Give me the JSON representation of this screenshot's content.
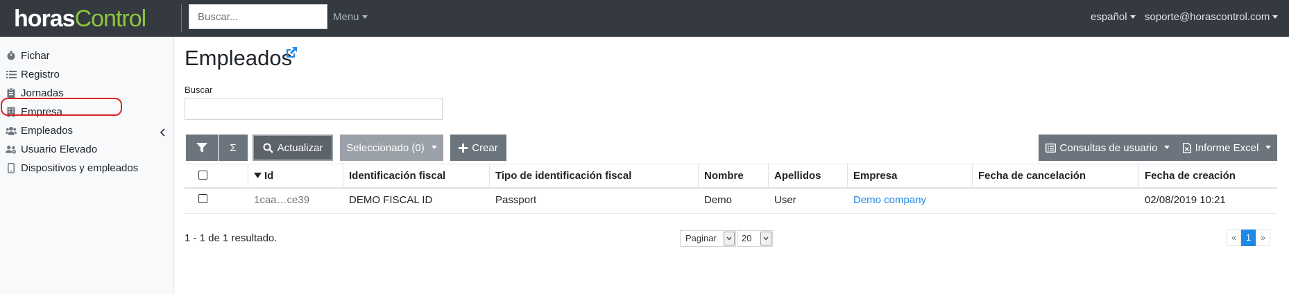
{
  "app": {
    "logo_part1": "horas",
    "logo_part2": "Control",
    "search_placeholder": "Buscar...",
    "menu_label": "Menu",
    "language_label": "español",
    "user_label": "soporte@horascontrol.com"
  },
  "colors": {
    "topbar": "#343a40",
    "logo_accent": "#8cc63e",
    "link": "#1e88e5",
    "button": "#6c757d",
    "highlight": "#e02020",
    "active_page": "#1e88e5"
  },
  "sidebar": {
    "items": [
      {
        "label": "Fichar",
        "icon": "stopwatch-icon"
      },
      {
        "label": "Registro",
        "icon": "list-icon"
      },
      {
        "label": "Jornadas",
        "icon": "clipboard-icon"
      },
      {
        "label": "Empresa",
        "icon": "building-icon"
      },
      {
        "label": "Empleados",
        "icon": "users-icon"
      },
      {
        "label": "Usuario Elevado",
        "icon": "users-cog-icon"
      },
      {
        "label": "Dispositivos y empleados",
        "icon": "mobile-icon"
      }
    ],
    "collapse_icon": "chevron-left-icon"
  },
  "main": {
    "title": "Empleados",
    "search_label": "Buscar",
    "toolbar": {
      "filter_icon": "filter-icon",
      "sum_label": "Σ",
      "refresh_label": "Actualizar",
      "selected_label": "Seleccionado (0)",
      "create_label": "Crear",
      "user_queries_label": "Consultas de usuario",
      "excel_label": "Informe Excel"
    },
    "table": {
      "columns": [
        "Id",
        "Identificación fiscal",
        "Tipo de identificación fiscal",
        "Nombre",
        "Apellidos",
        "Empresa",
        "Fecha de cancelación",
        "Fecha de creación"
      ],
      "rows": [
        {
          "id": "1caa…ce39",
          "fiscal_id": "DEMO FISCAL ID",
          "fiscal_type": "Passport",
          "nombre": "Demo",
          "apellidos": "User",
          "empresa": "Demo company",
          "fecha_cancelacion": "",
          "fecha_creacion": "02/08/2019 10:21"
        }
      ]
    },
    "result_count": "1 - 1 de 1 resultado.",
    "pagination": {
      "mode": "Paginar",
      "page_size": "20",
      "prev": "«",
      "current": "1",
      "next": "»"
    }
  }
}
